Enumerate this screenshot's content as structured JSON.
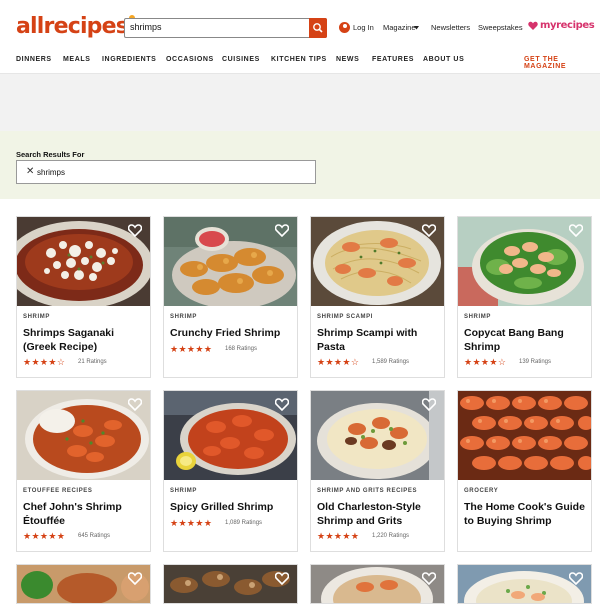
{
  "brand": {
    "logo": "allrecipes",
    "partner": "myrecipes",
    "accent": "#d54215",
    "partner_color": "#d6336c"
  },
  "header": {
    "search_value": "shrimps",
    "links": {
      "login": "Log In",
      "magazine": "Magazine",
      "newsletters": "Newsletters",
      "sweepstakes": "Sweepstakes"
    }
  },
  "nav": {
    "items": [
      "DINNERS",
      "MEALS",
      "INGREDIENTS",
      "OCCASIONS",
      "CUISINES",
      "KITCHEN TIPS",
      "NEWS",
      "FEATURES",
      "ABOUT US"
    ],
    "magazine": "GET THE MAGAZINE"
  },
  "search_results": {
    "label": "Search Results For",
    "query": "shrimps"
  },
  "cards": [
    {
      "tag": "SHRIMP",
      "title": "Shrimps Saganaki (Greek Recipe)",
      "rating": 4.5,
      "ratings": "21 Ratings",
      "image": "baked-shrimp-feta-dish"
    },
    {
      "tag": "SHRIMP",
      "title": "Crunchy Fried Shrimp",
      "rating": 5,
      "ratings": "168 Ratings",
      "image": "fried-shrimp-plate"
    },
    {
      "tag": "SHRIMP SCAMPI",
      "title": "Shrimp Scampi with Pasta",
      "rating": 4.5,
      "ratings": "1,589 Ratings",
      "image": "shrimp-pasta-plate"
    },
    {
      "tag": "SHRIMP",
      "title": "Copycat Bang Bang Shrimp",
      "rating": 4.5,
      "ratings": "139 Ratings",
      "image": "shrimp-salad-bowl"
    },
    {
      "tag": "ETOUFFEE RECIPES",
      "title": "Chef John's Shrimp Étouffée",
      "rating": 5,
      "ratings": "645 Ratings",
      "image": "shrimp-etouffee-bowl"
    },
    {
      "tag": "SHRIMP",
      "title": "Spicy Grilled Shrimp",
      "rating": 5,
      "ratings": "1,089 Ratings",
      "image": "grilled-shrimp-plate"
    },
    {
      "tag": "SHRIMP AND GRITS RECIPES",
      "title": "Old Charleston-Style Shrimp and Grits",
      "rating": 5,
      "ratings": "1,220 Ratings",
      "image": "shrimp-grits-bowl"
    },
    {
      "tag": "GROCERY",
      "title": "The Home Cook's Guide to Buying Shrimp",
      "rating": null,
      "ratings": "",
      "image": "raw-shrimp-grid"
    },
    {
      "image": "shrimp-dish-partial"
    },
    {
      "image": "shrimp-skewers-partial"
    },
    {
      "image": "shrimp-bowl-partial"
    },
    {
      "image": "shrimp-rice-partial"
    }
  ]
}
